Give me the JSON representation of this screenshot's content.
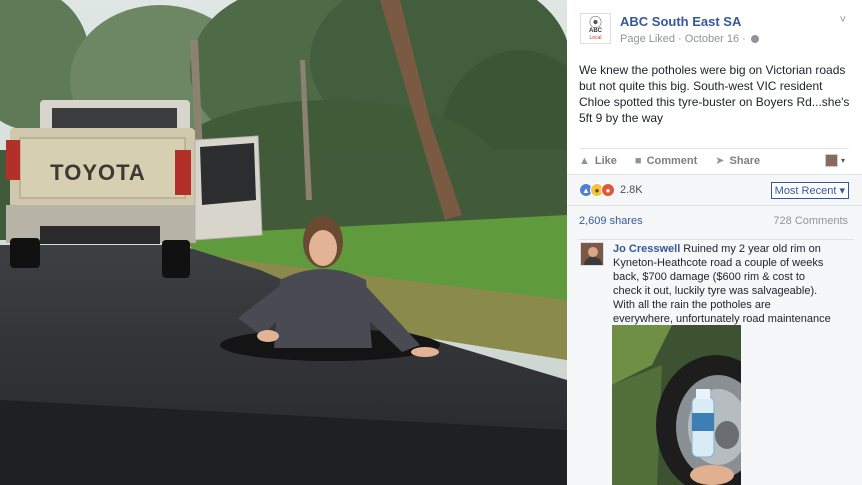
{
  "photo": {
    "vehicle_brand": "TOYOTA",
    "description_icon": "photo-scene"
  },
  "post": {
    "page_name": "ABC South East SA",
    "page_avatar_glyph": "⦿",
    "page_avatar_line1": "ABC",
    "page_avatar_line2": "Local",
    "status": "Page Liked",
    "separator": "·",
    "date": "October 16",
    "trailing_dot": "·",
    "body": "We knew the potholes were big on Victorian roads but not quite this big. South-west VIC resident Chloe spotted this tyre-buster on Boyers Rd...she's 5ft 9 by the way",
    "menu_chevron": "˅"
  },
  "actions": {
    "like": "Like",
    "comment": "Comment",
    "share": "Share",
    "like_icon": "thumbs-up-icon",
    "comment_icon": "speech-bubble-icon",
    "share_icon": "share-arrow-icon",
    "viewer_dropdown": "▾"
  },
  "reactions": {
    "count": "2.8K",
    "sort_label": "Most Recent",
    "sort_caret": "▾",
    "shares": "2,609 shares",
    "comments": "728 Comments"
  },
  "comment": {
    "author": "Jo Cresswell",
    "text": "Ruined my 2 year old rim on Kyneton-Heathcote road a couple of weeks back, $700 damage ($600 rim & cost to check it out, luckily tyre was salvageable). With all the rain the potholes are everywhere, unfortunately road maintenance is not what it used to be."
  },
  "colors": {
    "link": "#365899",
    "meta": "#90949c",
    "text": "#1d2129",
    "panel_bg": "#f6f7f9"
  }
}
